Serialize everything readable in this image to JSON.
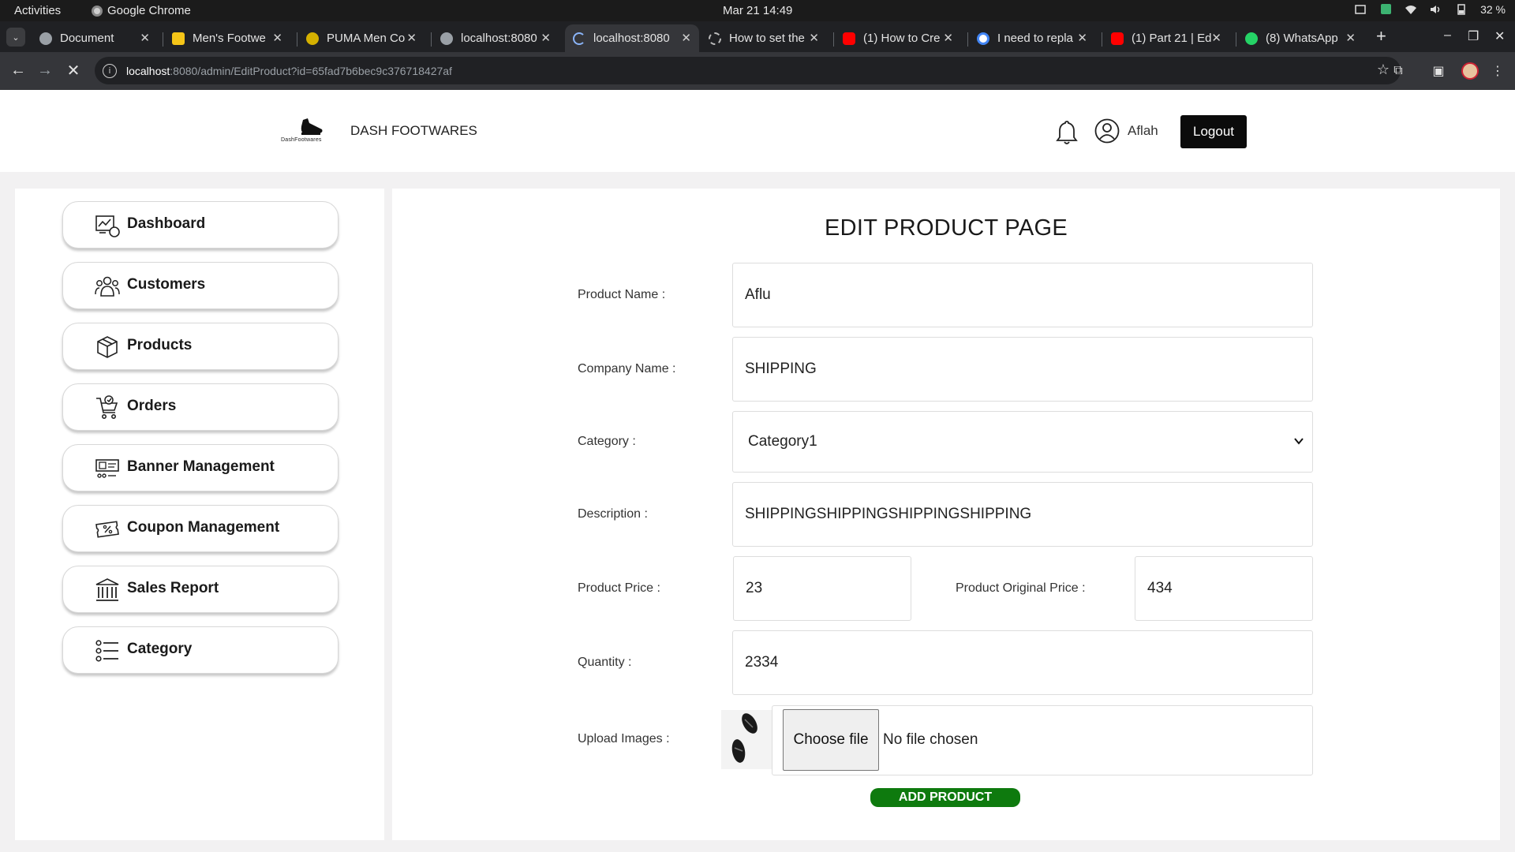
{
  "os": {
    "activities": "Activities",
    "app_name": "Google Chrome",
    "clock": "Mar 21  14:49",
    "battery": "32 %"
  },
  "browser": {
    "tabs": [
      {
        "label": "Document",
        "favicon_color": "#9aa0a6"
      },
      {
        "label": "Men's Footwe",
        "favicon_color": "#f5c518"
      },
      {
        "label": "PUMA Men Co",
        "favicon_color": "#d4b000"
      },
      {
        "label": "localhost:8080",
        "favicon_color": "#9aa0a6"
      },
      {
        "label": "localhost:8080",
        "favicon_color": "#35363a"
      },
      {
        "label": "How to set the",
        "favicon_color": "#9aa0a6"
      },
      {
        "label": "(1) How to Cre",
        "favicon_color": "#ff0000"
      },
      {
        "label": "I need to repla",
        "favicon_color": "#ffffff"
      },
      {
        "label": "(1) Part 21 | Ed",
        "favicon_color": "#ff0000"
      },
      {
        "label": "(8) WhatsApp",
        "favicon_color": "#25d366"
      }
    ],
    "url_host": "localhost",
    "url_path": ":8080/admin/EditProduct?id=65fad7b6bec9c376718427af"
  },
  "header": {
    "logo_text": "DashFootwares",
    "brand": "DASH FOOTWARES",
    "username": "Aflah",
    "logout_label": "Logout"
  },
  "sidebar": {
    "items": [
      {
        "label": "Dashboard",
        "icon": "dashboard-icon"
      },
      {
        "label": "Customers",
        "icon": "customers-icon"
      },
      {
        "label": "Products",
        "icon": "box-icon"
      },
      {
        "label": "Orders",
        "icon": "cart-icon"
      },
      {
        "label": "Banner Management",
        "icon": "banner-icon"
      },
      {
        "label": "Coupon Management",
        "icon": "coupon-icon"
      },
      {
        "label": "Sales Report",
        "icon": "bank-icon"
      },
      {
        "label": "Category",
        "icon": "list-icon"
      }
    ]
  },
  "form": {
    "title": "EDIT PRODUCT PAGE",
    "product_name_label": "Product Name :",
    "product_name_value": "Aflu",
    "company_name_label": "Company Name :",
    "company_name_value": "SHIPPING",
    "category_label": "Category :",
    "category_value": "Category1",
    "description_label": "Description :",
    "description_value": "SHIPPINGSHIPPINGSHIPPINGSHIPPING",
    "price_label": "Product Price :",
    "price_value": "23",
    "original_price_label": "Product Original Price :",
    "original_price_value": "434",
    "quantity_label": "Quantity :",
    "quantity_value": "2334",
    "upload_label": "Upload Images :",
    "choose_file_label": "Choose file",
    "no_file_label": "No file chosen",
    "submit_label": "ADD PRODUCT"
  },
  "colors": {
    "accent_green": "#0e7a0e",
    "logout_bg": "#0b0b0b"
  }
}
